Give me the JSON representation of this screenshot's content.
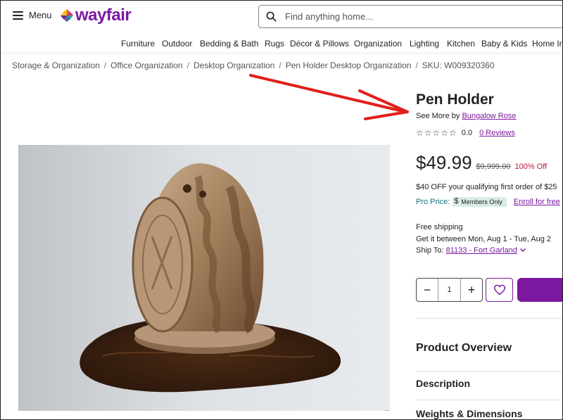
{
  "header": {
    "menu_label": "Menu",
    "logo_text": "wayfair",
    "search_placeholder": "Find anything home..."
  },
  "nav": {
    "items": [
      "Furniture",
      "Outdoor",
      "Bedding & Bath",
      "Rugs",
      "Décor & Pillows",
      "Organization",
      "Lighting",
      "Kitchen",
      "Baby & Kids",
      "Home In"
    ]
  },
  "breadcrumb": {
    "items": [
      "Storage & Organization",
      "Office Organization",
      "Desktop Organization",
      "Pen Holder Desktop Organization"
    ],
    "sku": "SKU: W009320360"
  },
  "product": {
    "title": "Pen Holder",
    "see_more_prefix": "See More by",
    "brand": "Bungalow Rose",
    "rating_value": "0.0",
    "reviews_label": "0 Reviews",
    "price": "$49.99",
    "old_price": "$9,999.00",
    "discount": "100% Off",
    "promo_text": "$40 OFF your qualifying first order of $25",
    "pro_price_label": "Pro Price:",
    "pro_dollar": "$",
    "members_badge": "Members Only",
    "enroll_label": "Enroll for free",
    "shipping": "Free shipping",
    "delivery": "Get it between Mon, Aug 1 - Tue, Aug 2",
    "ship_to_label": "Ship To:",
    "ship_to_location": "81133 - Fort Garland",
    "quantity": "1"
  },
  "sections": {
    "overview": "Product Overview",
    "description": "Description",
    "weights": "Weights & Dimensions"
  },
  "colors": {
    "brand": "#7b189f",
    "discount": "#b5183a",
    "pro_label": "#166f80",
    "annotation_arrow": "#e0201b"
  }
}
